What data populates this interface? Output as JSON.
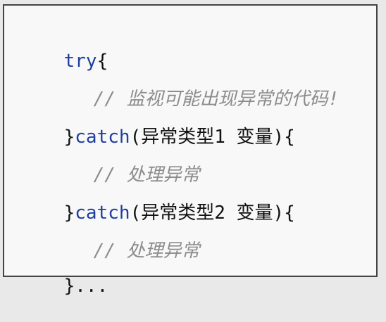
{
  "code": {
    "line1": {
      "kw": "try",
      "rest": "{"
    },
    "line2": {
      "comment": "// 监视可能出现异常的代码!"
    },
    "line3": {
      "pre": "}",
      "kw": "catch",
      "rest": "(异常类型1 变量){"
    },
    "line4": {
      "comment": "// 处理异常"
    },
    "line5": {
      "pre": "}",
      "kw": "catch",
      "rest": "(异常类型2 变量){"
    },
    "line6": {
      "comment": "// 处理异常"
    },
    "line7": {
      "text": "}..."
    }
  },
  "colors": {
    "keyword": "#1f3fa0",
    "comment": "#8c8c8c",
    "text": "#111111",
    "border": "#444444"
  }
}
